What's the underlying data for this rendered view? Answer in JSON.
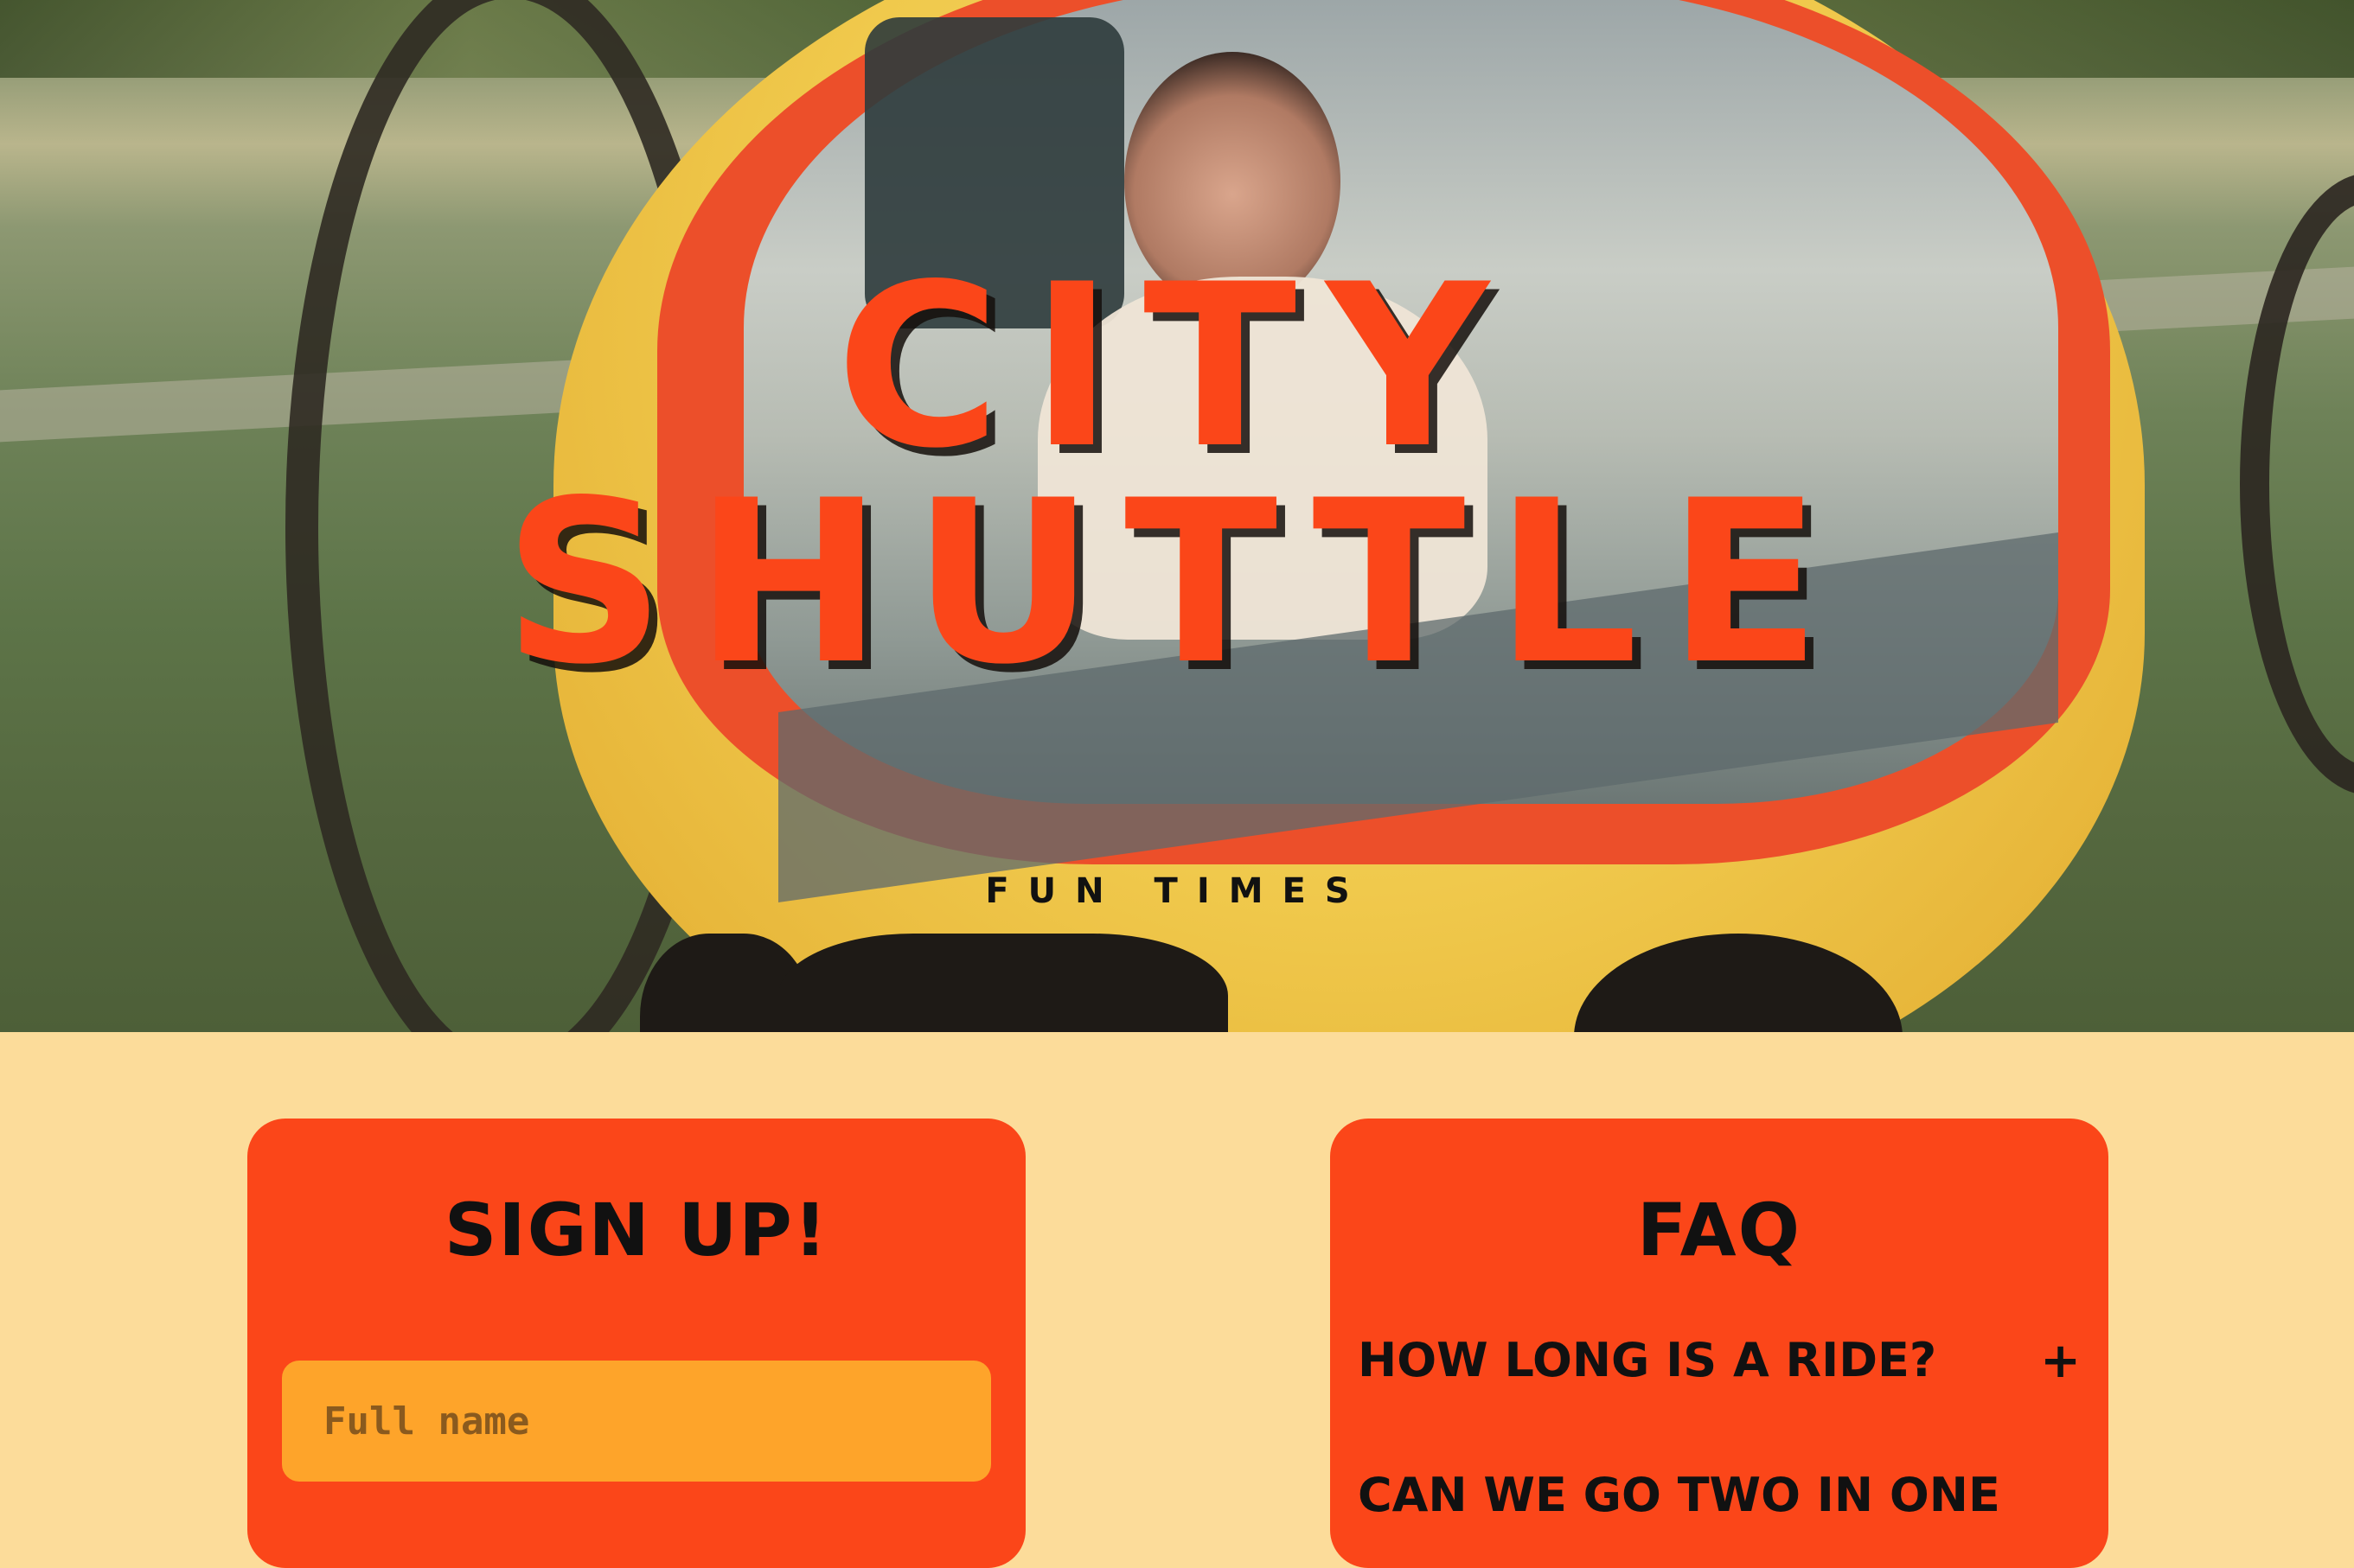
{
  "hero": {
    "title_line1": "City",
    "title_line2": "Shuttle",
    "subtitle": "Fun Times"
  },
  "signup": {
    "heading": "Sign Up!",
    "fullname_placeholder": "Full name"
  },
  "faq": {
    "heading": "FAQ",
    "items": [
      {
        "question": "How long is a ride?",
        "toggle": "+"
      },
      {
        "question": "Can we go two in one"
      }
    ]
  },
  "colors": {
    "page_bg": "#fcdc9a",
    "accent": "#fb4619",
    "input_bg": "#fea42a",
    "text": "#111111"
  }
}
